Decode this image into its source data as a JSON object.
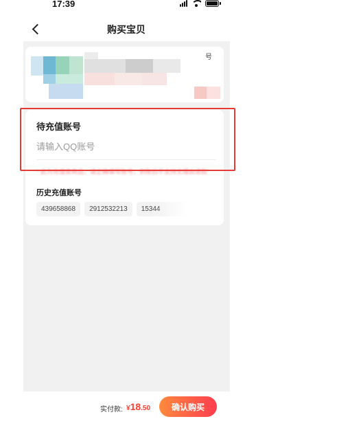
{
  "status_bar": {
    "time": "17:39",
    "icons": [
      "signal-icon",
      "wifi-icon",
      "battery-icon"
    ]
  },
  "nav": {
    "back_icon": "chevron-left-icon",
    "title": "购买宝贝"
  },
  "product": {
    "tag": "号"
  },
  "account": {
    "section_title": "待充值账号",
    "input_value": "",
    "input_placeholder": "请输入QQ账号",
    "notice": "* 此为充值类商品，请正确填写账号，到账后不支持无理由退款"
  },
  "history": {
    "title": "历史充值账号",
    "items": [
      "439658868",
      "2912532213",
      "15344"
    ]
  },
  "footer": {
    "pay_label": "实付款:",
    "currency": "¥",
    "amount_int": "18",
    "amount_dec": ".50",
    "buy_label": "确认购买"
  },
  "colors": {
    "accent_red": "#ff3b30",
    "button_gradient_start": "#ff8a3d",
    "button_gradient_end": "#ff3d4f",
    "highlight_box": "#e53935",
    "page_background": "#f1f1f2"
  }
}
